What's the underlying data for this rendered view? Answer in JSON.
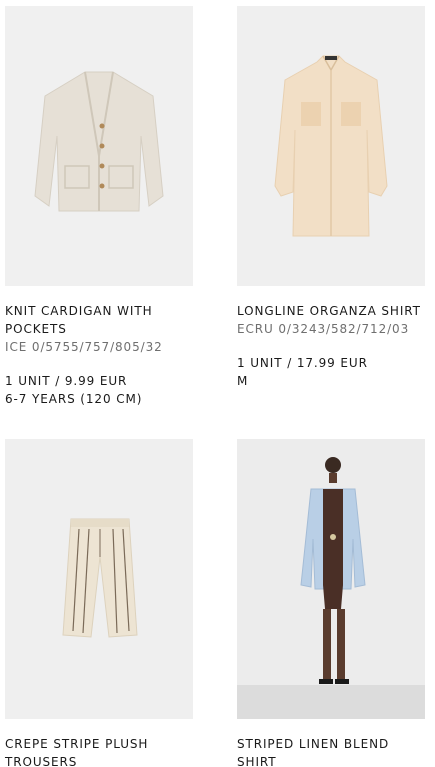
{
  "products": [
    {
      "name": "KNIT CARDIGAN WITH POCKETS",
      "ref": "ICE 0/5755/757/805/32",
      "quantity_price": "1 UNIT / 9.99 EUR",
      "size": "6-7 YEARS (120 CM)",
      "image_icon": "cardigan-image"
    },
    {
      "name": "LONGLINE ORGANZA SHIRT",
      "ref": "ECRU 0/3243/582/712/03",
      "quantity_price": "1 UNIT / 17.99 EUR",
      "size": "M",
      "image_icon": "shirt-image"
    },
    {
      "name": "CREPE STRIPE PLUSH TROUSERS",
      "image_icon": "trousers-image"
    },
    {
      "name": "STRIPED LINEN BLEND SHIRT",
      "image_icon": "model-shirt-image"
    }
  ]
}
